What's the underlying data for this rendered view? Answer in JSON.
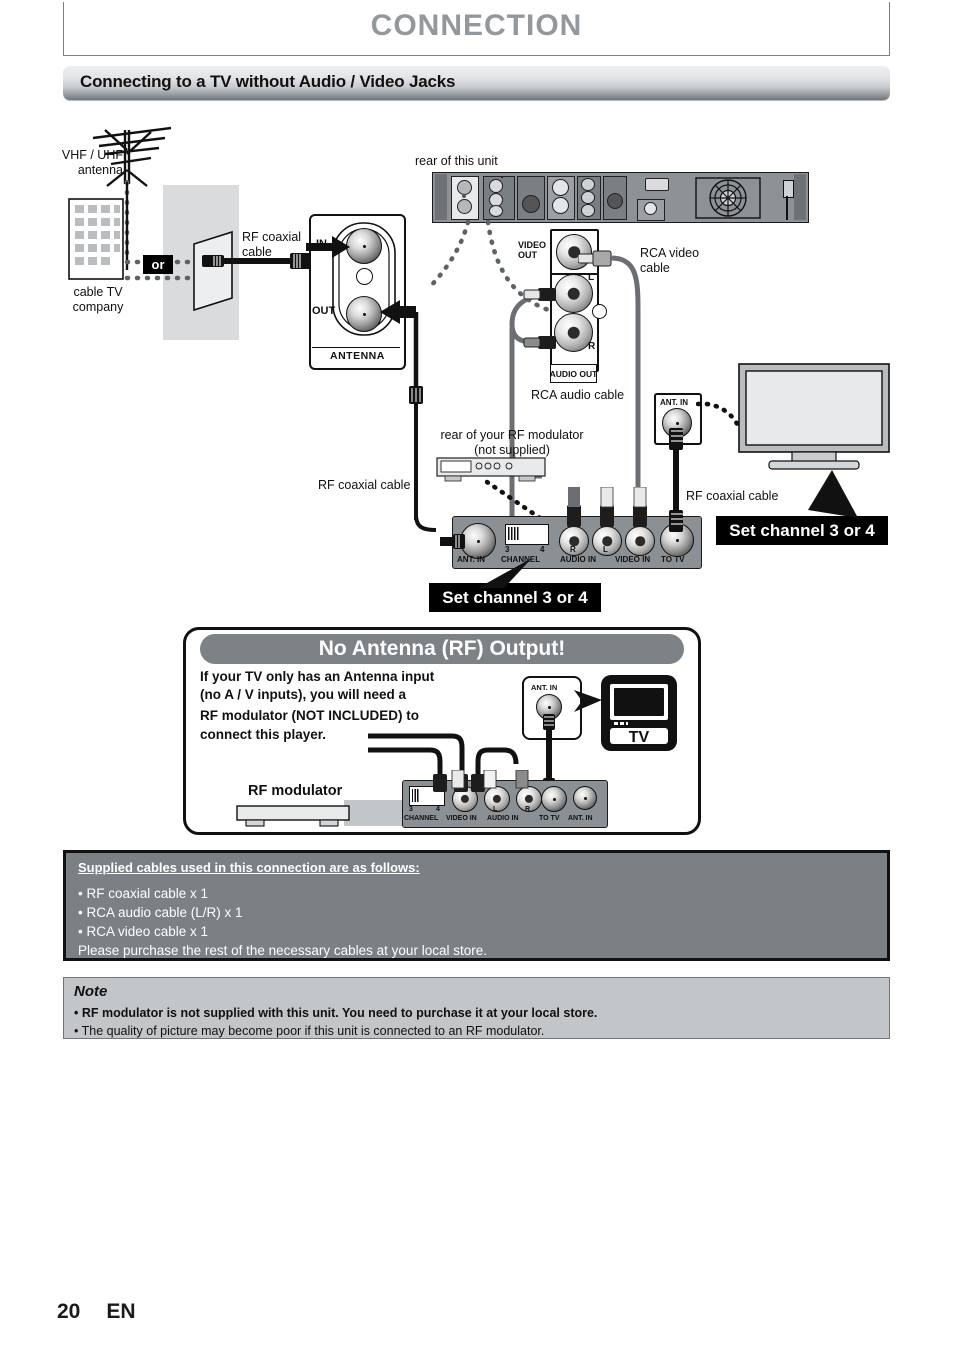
{
  "header": {
    "title": "CONNECTION",
    "section_title": "Connecting to a TV without Audio / Video Jacks"
  },
  "diagram": {
    "antenna_label": "VHF / UHF\nantenna",
    "cable_tv_label": "cable TV\ncompany",
    "or_label": "or",
    "rf_coaxial_cable_1": "RF coaxial\ncable",
    "rear_of_unit": "rear of this unit",
    "antenna_jack": {
      "in": "IN",
      "out": "OUT",
      "caption": "ANTENNA"
    },
    "av_jacks": {
      "video_out": "VIDEO\nOUT",
      "left": "L",
      "right": "R",
      "audio_out": "AUDIO OUT"
    },
    "rca_video_cable": "RCA video\ncable",
    "rca_audio_cable": "RCA audio cable",
    "rf_modulator_rear": "rear of your RF modulator\n(not supplied)",
    "rf_coaxial_cable_2": "RF coaxial cable",
    "rf_coaxial_cable_3": "RF coaxial cable",
    "tv_ant_in": "ANT. IN",
    "modulator_panel": {
      "ant_in": "ANT. IN",
      "channel": "CHANNEL",
      "channel_3": "3",
      "channel_4": "4",
      "audio_in": "AUDIO IN",
      "audio_r": "R",
      "audio_l": "L",
      "video_in": "VIDEO IN",
      "to_tv": "TO TV"
    },
    "set_channel_left": "Set channel 3 or 4",
    "set_channel_right": "Set channel 3 or 4"
  },
  "rf_callout": {
    "title": "No Antenna (RF) Output!",
    "line1": "If your TV only has an Antenna input",
    "line2": "(no A / V inputs), you will need a",
    "line3": "RF modulator (NOT INCLUDED) to",
    "line4": "connect this player.",
    "rf_modulator_label": "RF modulator",
    "tv_label": "TV",
    "tv_ant_in": "ANT. IN",
    "panel": {
      "channel": "CHANNEL",
      "channel_3": "3",
      "channel_4": "4",
      "video_in": "VIDEO IN",
      "audio_in": "AUDIO IN",
      "audio_l": "L",
      "audio_r": "R",
      "to_tv": "TO TV",
      "ant_in": "ANT. IN"
    }
  },
  "supplied": {
    "heading": "Supplied cables used in this connection are as follows:",
    "items": [
      "• RF coaxial cable x 1",
      "• RCA audio cable (L/R) x 1",
      "• RCA video cable x 1",
      "Please purchase the rest of the necessary cables at your local store."
    ]
  },
  "note": {
    "title": "Note",
    "items": [
      "• RF modulator is not supplied with this unit. You need to purchase it at your local store.",
      "•  The quality of picture may become poor if this unit is connected to an RF modulator."
    ]
  },
  "footer": {
    "page_number": "20",
    "language": "EN"
  },
  "colors": {
    "section_bar_dark": "#6f7478",
    "panel_gray": "#8b9094",
    "supplied_bg": "#7b8084",
    "note_bg": "#c2c6c9",
    "title_gray": "#93989d"
  }
}
